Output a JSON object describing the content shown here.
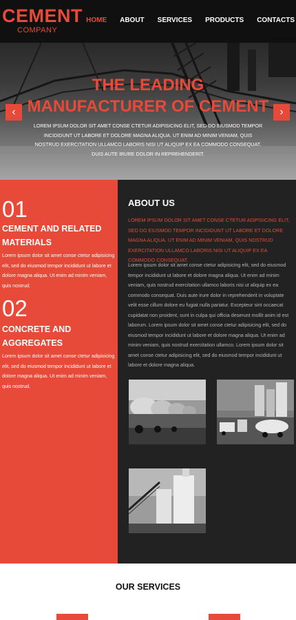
{
  "brand": {
    "name": "CEMENT",
    "tagline": "COMPANY"
  },
  "nav": [
    {
      "label": "HOME",
      "active": true
    },
    {
      "label": "ABOUT",
      "active": false
    },
    {
      "label": "SERVICES",
      "active": false
    },
    {
      "label": "PRODUCTS",
      "active": false
    },
    {
      "label": "CONTACTS",
      "active": false
    }
  ],
  "hero": {
    "title_line1": "THE LEADING",
    "title_line2": "MANUFACTURER OF CEMENT",
    "text": "LOREM IPSUM DOLOR SIT AMET CONSE CTETUR ADIPISICING ELIT, SED DO EIUSMOD TEMPOR INCIDIDUNT UT LABORE ET DOLORE MAGNA ALIQUA. UT ENIM AD MINIM VENIAM, QUIS NOSTRUD EXERCITATION ULLAMCO LABORIS NISI UT ALIQUIP EX EA COMMODO CONSEQUAT. DUIS AUTE IRURE DOLOR IN REPREHENDERIT.",
    "prev_icon": "chevron-left-icon",
    "next_icon": "chevron-right-icon"
  },
  "features": [
    {
      "number": "01",
      "title": "CEMENT AND RELATED MATERIALS",
      "text": "Lorem ipsum dolor sit amet conse ctetur adipisicing elit, sed do eiusmod tempor incididunt ut labore et dolore magna aliqua. Ut enim ad minim veniam, quis nostrud."
    },
    {
      "number": "02",
      "title": "CONCRETE AND AGGREGATES",
      "text": "Lorem ipsum dolor sit amet conse ctetur adipisicing elit, sed do eiusmod tempor incididunt ut labore et dolore magna aliqua. Ut enim ad minim veniam, quis nostrud."
    }
  ],
  "about": {
    "title": "ABOUT US",
    "lead": "LOREM IPSUM DOLOR SIT AMET CONSE CTETUR ADIPISICING ELIT, SED DO EIUSMOD TEMPOR INCIDIDUNT UT LABORE ET DOLORE MAGNA ALIQUA. UT ENIM AD MINIM VENIAM, QUIS NOSTRUD EXERCITATION ULLAMCO LABORIS NISI UT ALIQUIP EX EA COMMODO CONSEQUAT.",
    "body": "Lorem ipsum dolor sit amet conse ctetur adipisicing elit, sed do eiusmod tempor incididunt ut labore et dolore magna aliqua. Ut enim ad minim veniam, quis nostrud exercitation ullamco laboris nisi ut aliquip ex ea commodo consequat. Duis aute irure dolor in reprehenderit in voluptate velit esse cillum dolore eu fugiat nulla pariatur. Excepteur sint occaecat cupidatat non proident, sunt in culpa qui officia deserunt mollit anim id est laborum. Lorem ipsum dolor sit amet conse ctetur adipisicing elit, sed do eiusmod tempor incididunt ut labore et dolore magna aliqua. Ut enim ad minim veniam, quis nostrud exercitation ullamco. Lorem ipsum dolor sit amet conse ctetur adipisicing elit, sed do eiusmod tempor incididunt ut labore et dolore magna aliqua."
  },
  "gallery": [
    {
      "name": "mixer-trucks-photo"
    },
    {
      "name": "cement-plant-trucks-photo"
    },
    {
      "name": "cement-silos-photo"
    }
  ],
  "services": {
    "title": "OUR SERVICES"
  },
  "colors": {
    "accent": "#e84a3a",
    "dark": "#222222",
    "header": "#101010"
  }
}
